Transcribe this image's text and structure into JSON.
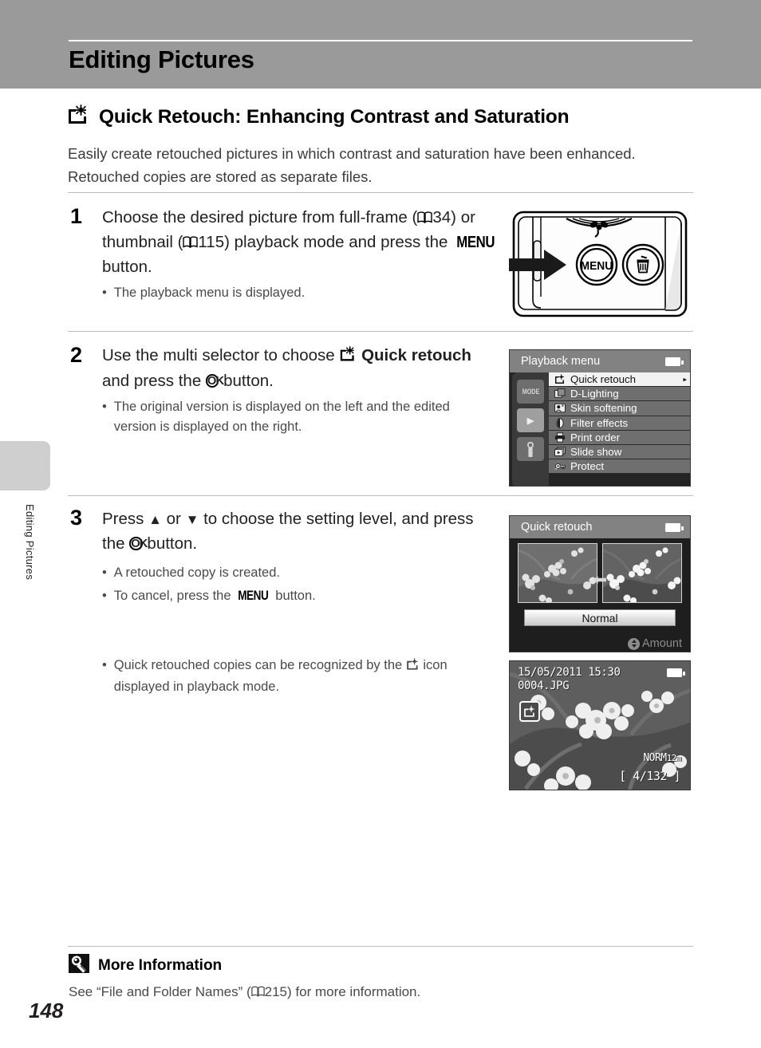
{
  "header": {
    "banner_title": "Editing Pictures",
    "banner_color": "#9a9a9a"
  },
  "side_tab": {
    "label": "Editing Pictures"
  },
  "page": {
    "number": "148"
  },
  "section": {
    "icon": "quick-retouch-icon",
    "title": "Quick Retouch: Enhancing Contrast and Saturation",
    "intro": "Easily create retouched pictures in which contrast and saturation have been enhanced. Retouched copies are stored as separate files."
  },
  "steps": [
    {
      "number": "1",
      "text_a": "Choose the desired picture from full-frame (",
      "ref_1": "34",
      "text_b": ") or thumbnail (",
      "ref_2": "115",
      "text_c": ") playback mode and press the ",
      "menu_label": "MENU",
      "text_d": " button.",
      "bullets": [
        "The playback menu is displayed."
      ]
    },
    {
      "number": "2",
      "text_a": "Use the multi selector to choose ",
      "bold_a": "Quick retouch",
      "text_b": " and press the ",
      "ok_label": "OK",
      "text_c": " button.",
      "bullets": [
        "The original version is displayed on the left and the edited version is displayed on the right."
      ]
    },
    {
      "number": "3",
      "text_a": "Press ",
      "up_glyph": "▲",
      "text_b": " or ",
      "down_glyph": "▼",
      "text_c": " to choose the setting level, and press the ",
      "ok_label": "OK",
      "text_d": " button.",
      "bullets_1": "A retouched copy is created.",
      "bullets_2_a": "To cancel, press the ",
      "bullets_2_menu": "MENU",
      "bullets_2_b": " button.",
      "bullets_3_a": "Quick retouched copies can be recognized by the ",
      "bullets_3_b": " icon displayed in playback mode."
    }
  ],
  "camera_figure": {
    "menu_button_label": "MENU",
    "delete_button_icon": "trash-icon",
    "macro_icon": "macro-flower-icon",
    "pointer": "arrow-pointer"
  },
  "playback_menu_screen": {
    "title": "Playback menu",
    "battery_icon": "battery-icon",
    "tabs": [
      {
        "name": "mode-tab",
        "label": "MODE",
        "selected": false
      },
      {
        "name": "playback-tab",
        "label": "▶",
        "selected": true
      },
      {
        "name": "setup-tab",
        "label": "ƒ",
        "selected": false
      }
    ],
    "items": [
      {
        "label": "Quick retouch",
        "icon": "quick-retouch-icon",
        "selected": true,
        "submenu_arrow": "▸"
      },
      {
        "label": "D-Lighting",
        "icon": "d-lighting-icon",
        "selected": false
      },
      {
        "label": "Skin softening",
        "icon": "skin-softening-icon",
        "selected": false
      },
      {
        "label": "Filter effects",
        "icon": "filter-effects-icon",
        "selected": false
      },
      {
        "label": "Print order",
        "icon": "printer-icon",
        "selected": false
      },
      {
        "label": "Slide show",
        "icon": "slide-show-icon",
        "selected": false
      },
      {
        "label": "Protect",
        "icon": "key-lock-icon",
        "selected": false
      }
    ]
  },
  "quick_retouch_screen": {
    "title": "Quick retouch",
    "battery_icon": "battery-icon",
    "level_value": "Normal",
    "hint_label": "Amount",
    "hint_icon": "up-down-icon",
    "left_thumb": "original-preview",
    "right_thumb": "retouched-preview"
  },
  "playback_frame_screen": {
    "date": "15/05/2011",
    "time": "15:30",
    "filename": "0004.JPG",
    "badge_icon": "quick-retouch-icon",
    "quality": "NORM",
    "image_size": "12m",
    "frame_counter": "[   4/132 ]",
    "battery_icon": "battery-icon"
  },
  "more_information": {
    "icon": "lightbulb-icon",
    "title": "More Information",
    "text_a": "See “File and Folder Names” (",
    "ref": "215",
    "text_b": ") for more information."
  }
}
